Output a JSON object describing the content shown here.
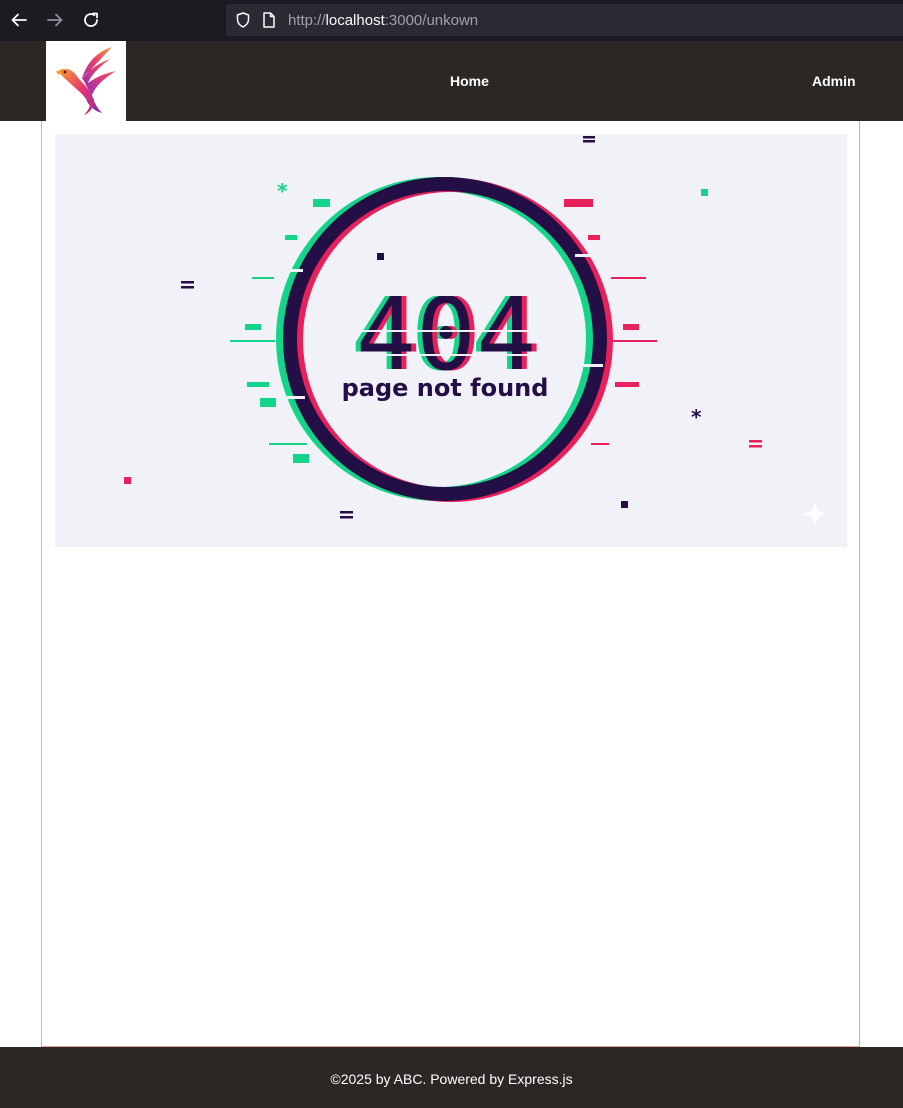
{
  "browser": {
    "url_prefix": "http://",
    "url_host": "localhost",
    "url_rest": ":3000/unkown"
  },
  "nav": {
    "home": "Home",
    "admin": "Admin"
  },
  "hero": {
    "code": "404",
    "message": "page not found"
  },
  "footer": {
    "text": "©2025 by ABC. Powered by Express.js"
  },
  "colors": {
    "header_bg": "#2b2725",
    "glitch_green": "#14d48a",
    "glitch_pink": "#e8215a",
    "glitch_dark": "#230f45"
  }
}
